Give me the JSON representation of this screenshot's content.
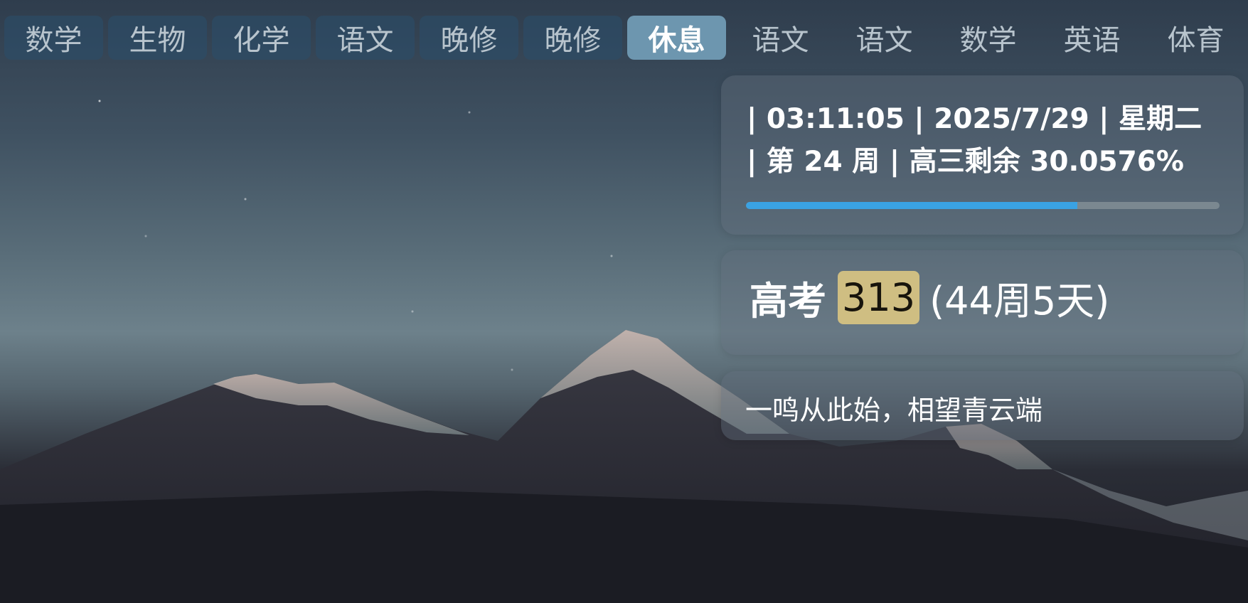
{
  "schedule": [
    {
      "label": "数学",
      "state": "done"
    },
    {
      "label": "生物",
      "state": "done"
    },
    {
      "label": "化学",
      "state": "done"
    },
    {
      "label": "语文",
      "state": "done"
    },
    {
      "label": "晚修",
      "state": "done"
    },
    {
      "label": "晚修",
      "state": "done"
    },
    {
      "label": "休息",
      "state": "current"
    },
    {
      "label": "语文",
      "state": "upcoming"
    },
    {
      "label": "语文",
      "state": "upcoming"
    },
    {
      "label": "数学",
      "state": "upcoming"
    },
    {
      "label": "英语",
      "state": "upcoming"
    },
    {
      "label": "体育",
      "state": "upcoming"
    }
  ],
  "time_card": {
    "line1": "| 03:11:05 | 2025/7/29 | 星期二",
    "line2": "| 第 24 周 | 高三剩余 30.0576%",
    "progress_elapsed_fraction": 0.7
  },
  "exam_card": {
    "label": "高考",
    "days": "313",
    "remaining": "(44周5天)"
  },
  "motto": "一鸣从此始，相望青云端",
  "colors": {
    "period_done_bg": "#2a4f6c",
    "period_current_bg": "#6d96af",
    "progress_fill": "#3aa2e3",
    "progress_track": "#7b8890",
    "days_highlight": "#cfbe82"
  }
}
